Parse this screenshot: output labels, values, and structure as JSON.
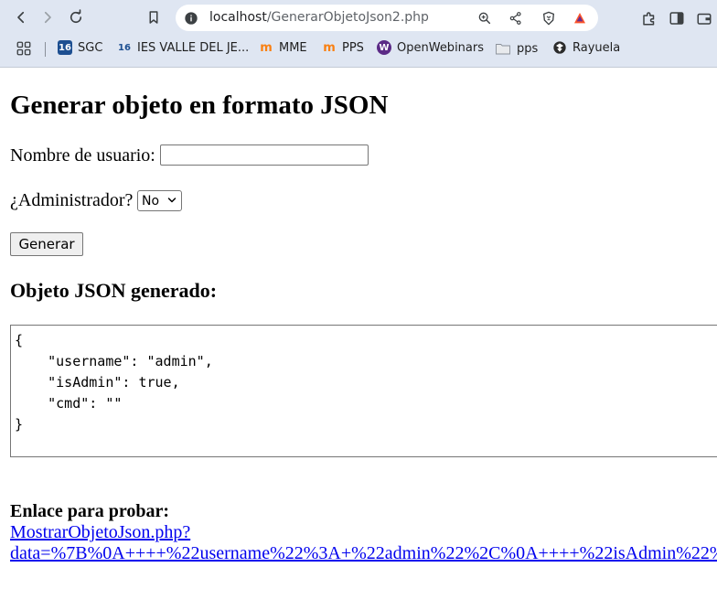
{
  "browser": {
    "url_host": "localhost",
    "url_path": "/GenerarObjetoJson2.php",
    "bookmarks": [
      {
        "label": "SGC",
        "icon": "ies-logo-icon"
      },
      {
        "label": "IES VALLE DEL JE...",
        "icon": "ies-logo-icon"
      },
      {
        "label": "MME",
        "icon": "moodle-icon"
      },
      {
        "label": "PPS",
        "icon": "moodle-icon"
      },
      {
        "label": "OpenWebinars",
        "icon": "openwebinars-icon"
      },
      {
        "label": "pps",
        "icon": "folder-icon"
      },
      {
        "label": "Rayuela",
        "icon": "rayuela-icon"
      }
    ]
  },
  "page": {
    "title": "Generar objeto en formato JSON",
    "username_label": "Nombre de usuario:",
    "username_value": "",
    "admin_label": "¿Administrador?",
    "admin_selected": "No",
    "generate_button": "Generar",
    "json_heading": "Objeto JSON generado:",
    "json_output": "{\n    \"username\": \"admin\",\n    \"isAdmin\": true,\n    \"cmd\": \"\"\n}",
    "link_label": "Enlace para probar:",
    "link_line1": "MostrarObjetoJson.php?",
    "link_line2": "data=%7B%0A++++%22username%22%3A+%22admin%22%2C%0A++++%22isAdmin%22%"
  },
  "colors": {
    "chrome_bg": "#dfe6f2",
    "link": "#0000ee"
  }
}
